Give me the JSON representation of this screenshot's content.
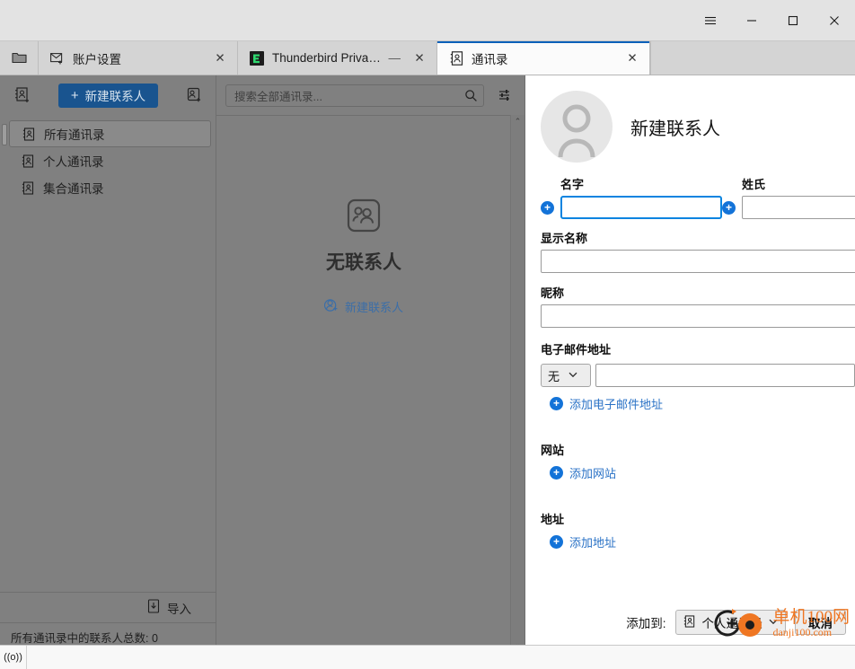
{
  "window": {
    "controls": [
      {
        "name": "app-menu",
        "glyph": "menu"
      },
      {
        "name": "minimize",
        "glyph": "minimize"
      },
      {
        "name": "maximize",
        "glyph": "maximize"
      },
      {
        "name": "close",
        "glyph": "close"
      }
    ]
  },
  "tabs": {
    "spaces_icon": "folder-icon",
    "items": [
      {
        "label": "账户设置",
        "icon": "mail-settings-icon",
        "active": false,
        "close": "✕"
      },
      {
        "label": "Thunderbird Privacy Notice",
        "icon": "thunderbird-icon",
        "active": false,
        "close": "✕",
        "trailing": "—"
      },
      {
        "label": "通讯录",
        "icon": "addressbook-icon",
        "active": true,
        "close": "✕"
      }
    ]
  },
  "sidebar": {
    "toolbar": {
      "left_icon": "addressbook-new-icon",
      "new_contact_label": "新建联系人",
      "new_contact_plus": "+",
      "right_icon": "new-contact-list-icon"
    },
    "books": [
      {
        "label": "所有通讯录",
        "icon": "addressbook-icon",
        "selected": true
      },
      {
        "label": "个人通讯录",
        "icon": "addressbook-icon",
        "selected": false
      },
      {
        "label": "集合通讯录",
        "icon": "addressbook-icon",
        "selected": false
      }
    ],
    "import": {
      "label": "导入",
      "icon": "import-icon"
    },
    "status": "所有通讯录中的联系人总数: 0"
  },
  "contacts_pane": {
    "search": {
      "placeholder": "搜索全部通讯录...",
      "icon": "search-icon"
    },
    "display_options_icon": "display-options-icon",
    "empty": {
      "icon": "contacts-empty-icon",
      "title": "无联系人",
      "link_label": "新建联系人",
      "link_icon": "new-contact-icon"
    },
    "scrollbar": {
      "up": "⌃",
      "down": "⌄"
    }
  },
  "editor": {
    "avatar_icon": "person-avatar-icon",
    "title": "新建联系人",
    "fields": {
      "first_name": {
        "label": "名字",
        "value": "",
        "focused": true,
        "add_icon": "plus-circle-icon"
      },
      "last_name": {
        "label": "姓氏",
        "value": "",
        "focused": false,
        "add_icon": "plus-circle-icon"
      },
      "display_name": {
        "label": "显示名称",
        "value": ""
      },
      "nickname": {
        "label": "昵称",
        "value": ""
      }
    },
    "sections": [
      {
        "heading": "电子邮件地址",
        "type_select": {
          "value": "无",
          "chevron": "⌄"
        },
        "email_value": "",
        "add_label": "添加电子邮件地址",
        "add_icon": "plus-circle-icon"
      },
      {
        "heading": "网站",
        "add_label": "添加网站",
        "add_icon": "plus-circle-icon"
      },
      {
        "heading": "地址",
        "add_label": "添加地址",
        "add_icon": "plus-circle-icon"
      }
    ],
    "actions": {
      "add_to_label": "添加到:",
      "book_select": {
        "value": "个人通讯录",
        "icon": "addressbook-icon",
        "chevron": "⌄"
      },
      "cancel_label": "取消"
    }
  },
  "statusbar": {
    "connection_icon": "((o))"
  },
  "watermark": {
    "line1": "单机100网",
    "line2": "danji100.com"
  },
  "colors": {
    "accent_blue": "#0a60b9",
    "primary_button": "#19548f",
    "link_blue": "#2a72c6",
    "plus_blue": "#1373d8",
    "focus_blue": "#0a84e0",
    "dim_overlay": "#808080",
    "watermark_orange": "#ef7622"
  }
}
